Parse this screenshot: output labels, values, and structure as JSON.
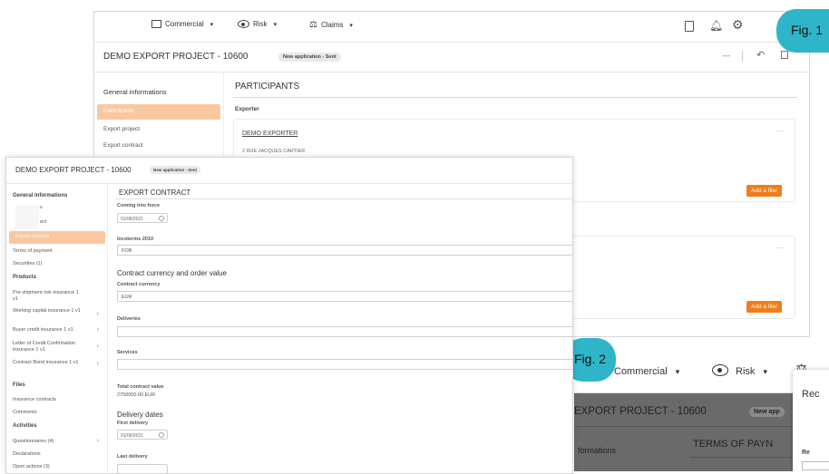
{
  "fig1": {
    "badge": "Fig. 1",
    "nav": {
      "commercial": "Commercial",
      "risk": "Risk",
      "claims": "Claims",
      "dropdown_glyph": "▾"
    },
    "project_title": "DEMO EXPORT PROJECT - 10600",
    "status_badge": "New application - Sent",
    "sidebar": {
      "header": "General informations",
      "items": [
        "Participants",
        "Export project",
        "Export contract"
      ]
    },
    "main": {
      "title": "PARTICIPANTS",
      "exporter_label": "Exporter",
      "exporter_name": "DEMO EXPORTER",
      "exporter_address": "2 RUE JACQUES CARTIER",
      "add_filer_1": "Add a filer",
      "add_filer_2": "Add a filer",
      "more_glyph": "···"
    }
  },
  "fig2": {
    "badge": "Fig. 2",
    "nav": {
      "commercial": "Commercial",
      "risk": "Risk",
      "dropdown_glyph": "▾"
    },
    "project_title": "EXPORT PROJECT - 10600",
    "status_badge": "New app",
    "sidebar_label": "formations",
    "main_title": "TERMS OF PAYN",
    "modal_title": "Rec",
    "modal_label": "Re"
  },
  "front": {
    "project_title": "DEMO EXPORT PROJECT - 10600",
    "status_badge": "New application - Sent",
    "sidebar": {
      "general_header": "General informations",
      "general_items": [
        {
          "label": "s"
        },
        {
          "label": "ect"
        },
        {
          "label": "Export contract"
        },
        {
          "label": "Terms of payment"
        },
        {
          "label": "Securities (1)"
        }
      ],
      "products_header": "Products",
      "products_items": [
        {
          "label": "Pre-shipment risk insurance 1 v1"
        },
        {
          "label": "Working capital insurance 1 v1"
        },
        {
          "label": "Buyer credit insurance 1 v1"
        },
        {
          "label": "Letter of Credit Confirmation insurance 1 v1"
        },
        {
          "label": "Contract Bond insurance 1 v1"
        }
      ],
      "files_header": "Files",
      "files_items": [
        {
          "label": "Insurance contracts"
        },
        {
          "label": "Comments"
        }
      ],
      "activities_header": "Activities",
      "activities_items": [
        {
          "label": "Questionnaires (4)"
        },
        {
          "label": "Declarations"
        },
        {
          "label": "Open actions (3)"
        }
      ],
      "chevron": "›"
    },
    "main": {
      "title": "EXPORT CONTRACT",
      "coming_into_force_label": "Coming into force",
      "coming_into_force_value": "01/06/2021",
      "incoterms_label": "Incoterms 2010",
      "incoterms_value": "FOB",
      "currency_section": "Contract currency and order value",
      "currency_label": "Contract currency",
      "currency_value": "EUR",
      "deliveries_label": "Deliveries",
      "services_label": "Services",
      "total_label": "Total contract value",
      "total_value": "2750000.00 EUR",
      "delivery_section": "Delivery dates",
      "first_delivery_label": "First delivery",
      "first_delivery_value": "01/06/2021",
      "last_delivery_label": "Last delivery"
    }
  },
  "colors": {
    "accent_orange": "#f07d1a",
    "sidebar_active": "#f9c8a0",
    "badge_teal": "#2fb5c9"
  }
}
